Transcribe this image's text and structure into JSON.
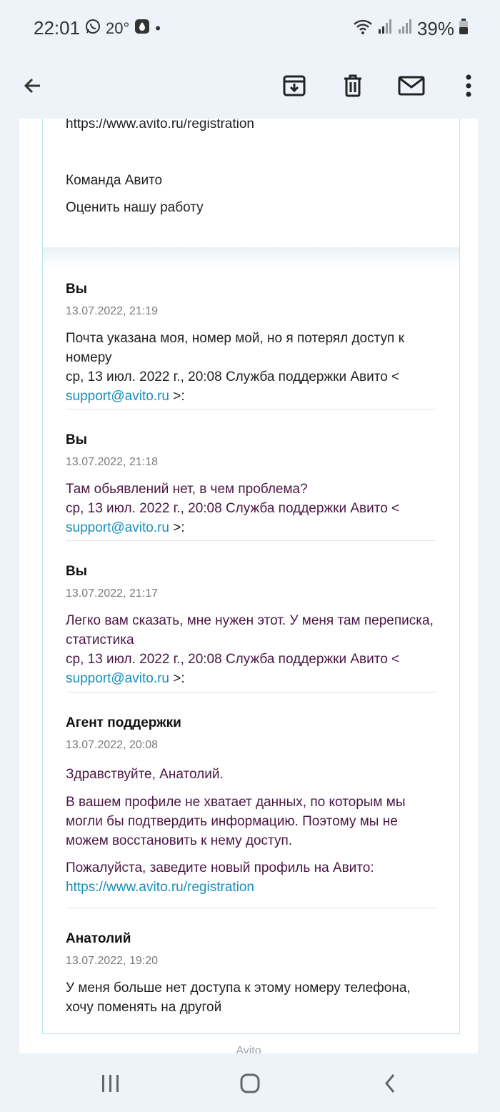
{
  "status_bar": {
    "time": "22:01",
    "temperature": "20°",
    "dot": "•",
    "battery": "39%",
    "icons": [
      "whatsapp-icon",
      "temperature-icon",
      "dnd-icon",
      "wifi-icon",
      "signal-icon",
      "signal-icon",
      "battery-icon"
    ]
  },
  "app_bar": {
    "icons": [
      "back-arrow-icon",
      "archive-icon",
      "delete-icon",
      "mark-unread-icon",
      "more-vert-icon"
    ]
  },
  "top_card": {
    "link": "https://www.avito.ru/registration",
    "signature": "Команда Авито",
    "rate_link": "Оценить нашу работу"
  },
  "messages": [
    {
      "author": "Вы",
      "date": "13.07.2022, 21:19",
      "text": "Почта указана моя, номер мой, но я потерял доступ к номеру",
      "quote_prefix": "ср, 13 июл. 2022 г., 20:08 Служба поддержки Авито <",
      "quote_email": "support@avito.ru",
      "quote_suffix": ">:"
    },
    {
      "author": "Вы",
      "date": "13.07.2022, 21:18",
      "text": "Там обьявлений нет, в чем проблема?",
      "quote_prefix": "ср, 13 июл. 2022 г., 20:08 Служба поддержки Авито <",
      "quote_email": "support@avito.ru",
      "quote_suffix": ">:"
    },
    {
      "author": "Вы",
      "date": "13.07.2022, 21:17",
      "text": "Легко вам сказать, мне нужен этот. У меня там переписка, статистика",
      "quote_prefix": "ср, 13 июл. 2022 г., 20:08 Служба поддержки Авито <",
      "quote_email": "support@avito.ru",
      "quote_suffix": ">:"
    },
    {
      "author": "Агент поддержки",
      "date": "13.07.2022, 20:08",
      "greeting": "Здравствуйте, Анатолий.",
      "paragraph": "В вашем профиле не хватает данных, по которым мы могли бы подтвердить информацию. Поэтому мы не можем восстановить к нему доступ.",
      "request": "Пожалуйста, заведите новый профиль на Авито:",
      "link": "https://www.avito.ru/registration"
    },
    {
      "author": "Анатолий",
      "date": "13.07.2022, 19:20",
      "text": "У меня больше нет доступа к этому номеру телефона, хочу поменять на другой"
    }
  ],
  "footer_peek": "Avito",
  "nav_bar": {
    "icons": [
      "recents-icon",
      "home-icon",
      "back-icon"
    ]
  },
  "colors": {
    "background": "#eef2f9",
    "link": "#1a8fb8",
    "purple_text": "#4c1745",
    "card_border": "#bfe3ee"
  }
}
